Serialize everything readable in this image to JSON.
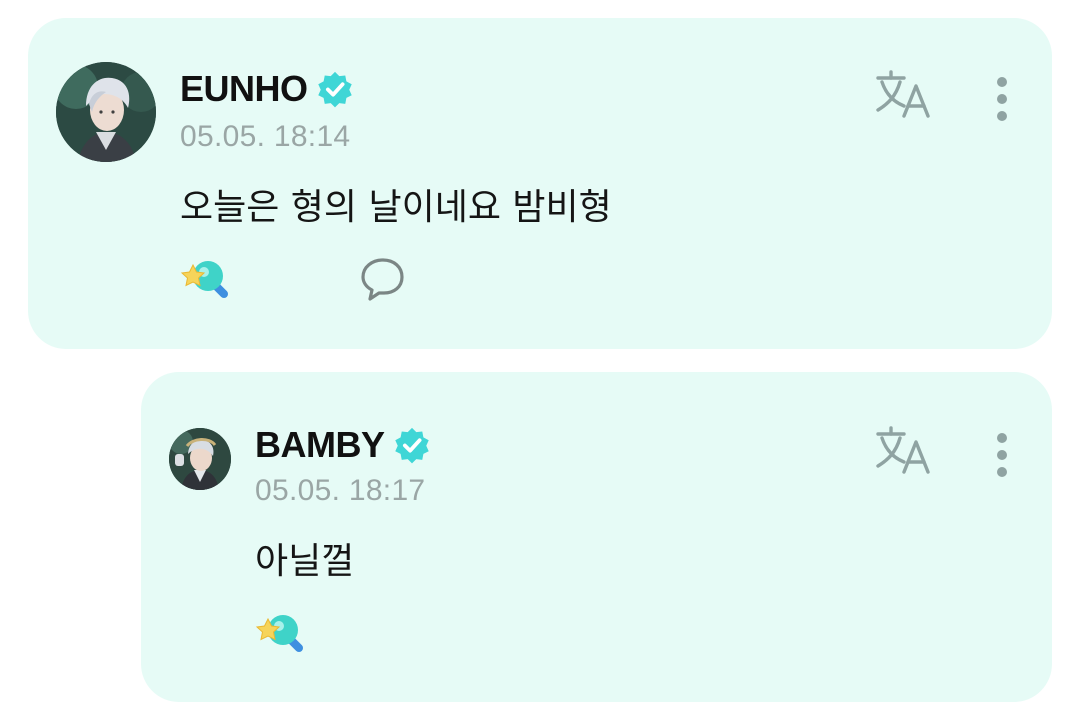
{
  "comments": [
    {
      "author": "EUNHO",
      "verified": true,
      "timestamp": "05.05. 18:14",
      "text": "오늘은 형의 날이네요 밤비형",
      "actions": {
        "translate_icon": "translate-icon",
        "more_icon": "more-vertical-icon",
        "reaction_icon": "star-lightstick-icon",
        "comment_icon": "speech-bubble-icon"
      }
    },
    {
      "author": "BAMBY",
      "verified": true,
      "timestamp": "05.05. 18:17",
      "text": "아닐껄",
      "actions": {
        "translate_icon": "translate-icon",
        "more_icon": "more-vertical-icon",
        "reaction_icon": "star-lightstick-icon"
      }
    }
  ],
  "colors": {
    "card_background": "#e6fbf6",
    "verified_badge": "#3fd6d6",
    "icon_gray": "#8fa3a2",
    "timestamp_gray": "#9aa6a5"
  }
}
